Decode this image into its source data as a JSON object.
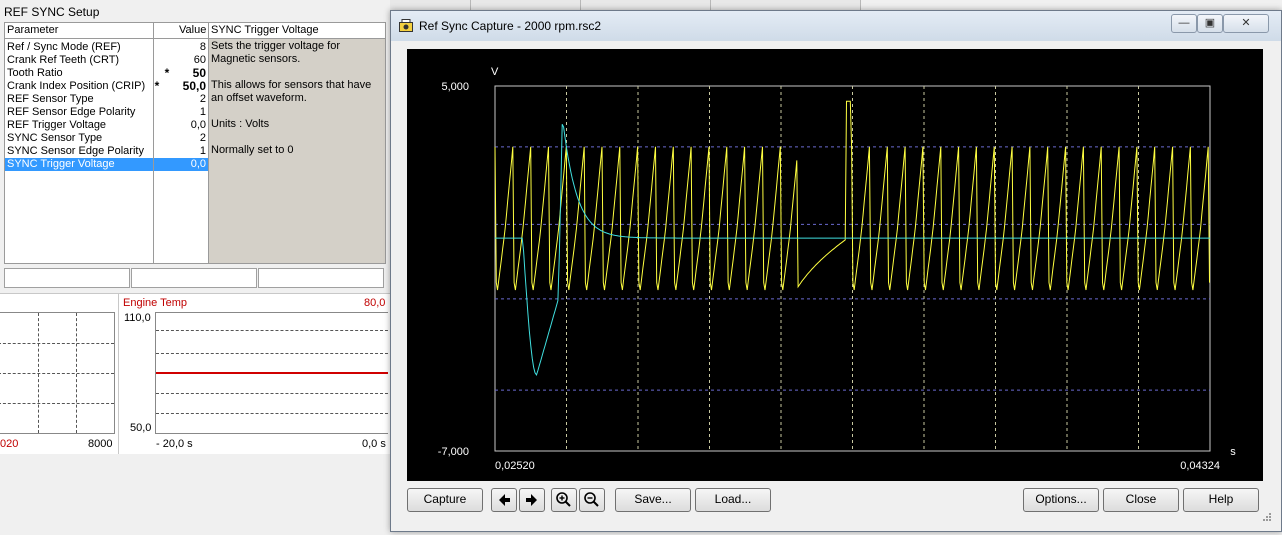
{
  "setup": {
    "title": "REF SYNC Setup",
    "header_param": "Parameter",
    "header_value": "Value",
    "header_desc": "SYNC Trigger Voltage",
    "rows": [
      {
        "name": "Ref / Sync Mode  (REF)",
        "value": "8",
        "bold": false,
        "star": ""
      },
      {
        "name": "Crank Ref Teeth  (CRT)",
        "value": "60",
        "bold": false,
        "star": ""
      },
      {
        "name": "Tooth Ratio",
        "value": "50",
        "bold": true,
        "star": "*"
      },
      {
        "name": "Crank Index Position  (CRIP)",
        "value": "50,0",
        "bold": true,
        "star": "*"
      },
      {
        "name": "REF Sensor Type",
        "value": "2",
        "bold": false,
        "star": ""
      },
      {
        "name": "REF Sensor Edge Polarity",
        "value": "1",
        "bold": false,
        "star": ""
      },
      {
        "name": "REF Trigger Voltage",
        "value": "0,0",
        "bold": false,
        "star": ""
      },
      {
        "name": "SYNC Sensor Type",
        "value": "2",
        "bold": false,
        "star": ""
      },
      {
        "name": "SYNC Sensor Edge Polarity",
        "value": "1",
        "bold": false,
        "star": ""
      },
      {
        "name": "SYNC Trigger Voltage",
        "value": "0,0",
        "bold": false,
        "star": "",
        "selected": true
      }
    ],
    "description": [
      "Sets the trigger voltage for Magnetic sensors.",
      "This allows for sensors that have an offset waveform.",
      "Units : Volts",
      "Normally set to 0"
    ]
  },
  "gauges": {
    "left": {
      "min_label": "020",
      "max_label": "8000"
    },
    "engine_temp": {
      "title": "Engine Temp",
      "value": "80,0",
      "ymax": "110,0",
      "ymin": "50,0",
      "x_start": "- 20,0 s",
      "x_end": "0,0 s",
      "level_fraction": 0.5
    }
  },
  "capture": {
    "window_title": "Ref Sync Capture - 2000 rpm.rsc2",
    "y_unit": "V",
    "x_unit": "s",
    "y_max": "5,000",
    "y_min": "-7,000",
    "x_min": "0,02520",
    "x_max": "0,04324",
    "colors": {
      "ref": "#ffff40",
      "sync": "#40e0e0",
      "grid": "#c8c8c8",
      "bg": "#000000"
    },
    "buttons": {
      "capture": "Capture",
      "save": "Save...",
      "load": "Load...",
      "options": "Options...",
      "close": "Close",
      "help": "Help"
    },
    "icons": [
      "arrow-left-icon",
      "arrow-right-icon",
      "zoom-in-icon",
      "zoom-out-icon"
    ]
  },
  "chart_data": {
    "type": "line",
    "title": "",
    "xlabel": "s",
    "ylabel": "V",
    "xlim": [
      0.0252,
      0.04324
    ],
    "ylim": [
      -7.0,
      5.0
    ],
    "grid": true,
    "series": [
      {
        "name": "",
        "color": "#ffff40",
        "shape": "periodic tooth signal, peaks ~3.0 V, troughs ~-2.0 V, 2 missing teeth gap near 0.0341 s"
      },
      {
        "name": "",
        "color": "#40e0e0",
        "shape": "flat ~0.0 V with pulse: peak ~4.0 V at 0.0269 s, dip ~-4.5 V at 0.0262 s"
      }
    ]
  }
}
